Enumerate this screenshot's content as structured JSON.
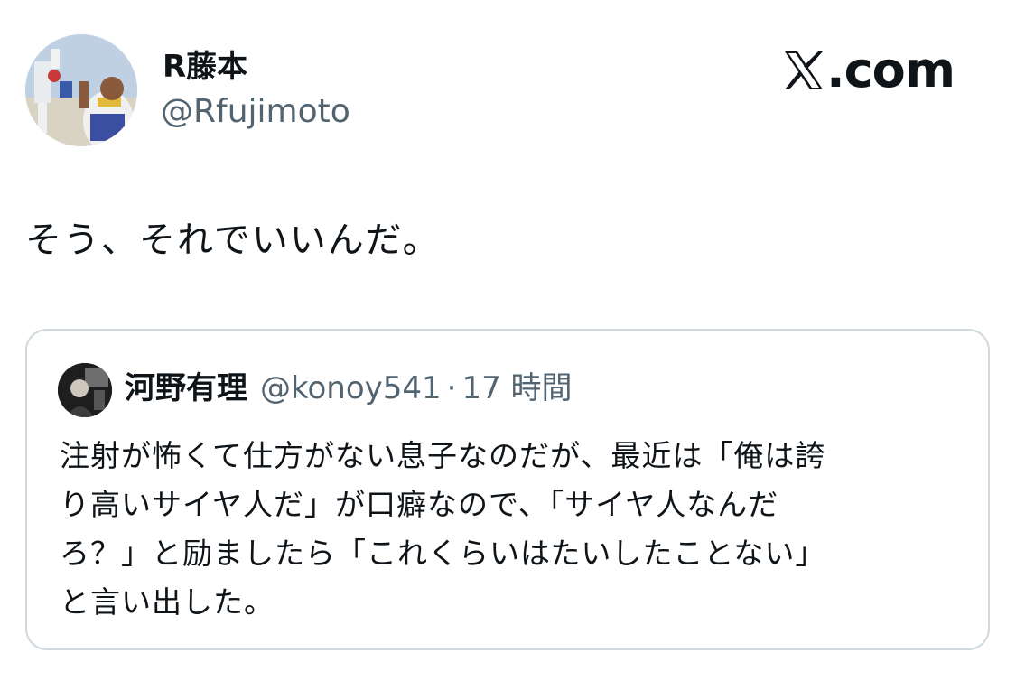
{
  "author": {
    "display_name": "R藤本",
    "handle": "@Rfujimoto",
    "avatar_icon": "user-avatar-icon"
  },
  "brand": {
    "label": ".com",
    "logo_icon": "x-logo-icon"
  },
  "tweet": {
    "text": "そう、それでいいんだ。"
  },
  "quoted_tweet": {
    "display_name": "河野有理",
    "handle": "@konoy541",
    "separator": "·",
    "time": "17 時間",
    "text_lines": [
      "注射が怖くて仕方がない息子なのだが、最近は「俺は誇",
      "り高いサイヤ人だ」が口癖なので、「サイヤ人なんだ",
      "ろ？」と励ましたら「これくらいはたいしたことない」",
      "と言い出した。"
    ]
  },
  "colors": {
    "text": "#0f1419",
    "secondary_text": "#536471",
    "border": "#cfd9de",
    "background": "#ffffff"
  }
}
